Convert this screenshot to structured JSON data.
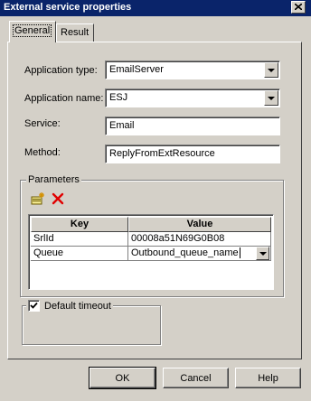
{
  "window": {
    "title": "External service properties"
  },
  "tabs": [
    {
      "label": "General",
      "active": true
    },
    {
      "label": "Result",
      "active": false
    }
  ],
  "form": {
    "application_type_label": "Application type:",
    "application_type_value": "EmailServer",
    "application_name_label": "Application name:",
    "application_name_value": "ESJ",
    "service_label": "Service:",
    "service_value": "Email",
    "method_label": "Method:",
    "method_value": "ReplyFromExtResource"
  },
  "parameters": {
    "group_title": "Parameters",
    "columns": [
      "Key",
      "Value"
    ],
    "rows": [
      {
        "key": "SrlId",
        "value": "00008a51N69G0B08"
      },
      {
        "key": "Queue",
        "value": "Outbound_queue_name"
      }
    ],
    "toolbar_icons": [
      "add-parameter-icon",
      "delete-icon"
    ]
  },
  "timeout": {
    "label": "Default timeout",
    "checked": true
  },
  "buttons": {
    "ok": "OK",
    "cancel": "Cancel",
    "help": "Help"
  }
}
